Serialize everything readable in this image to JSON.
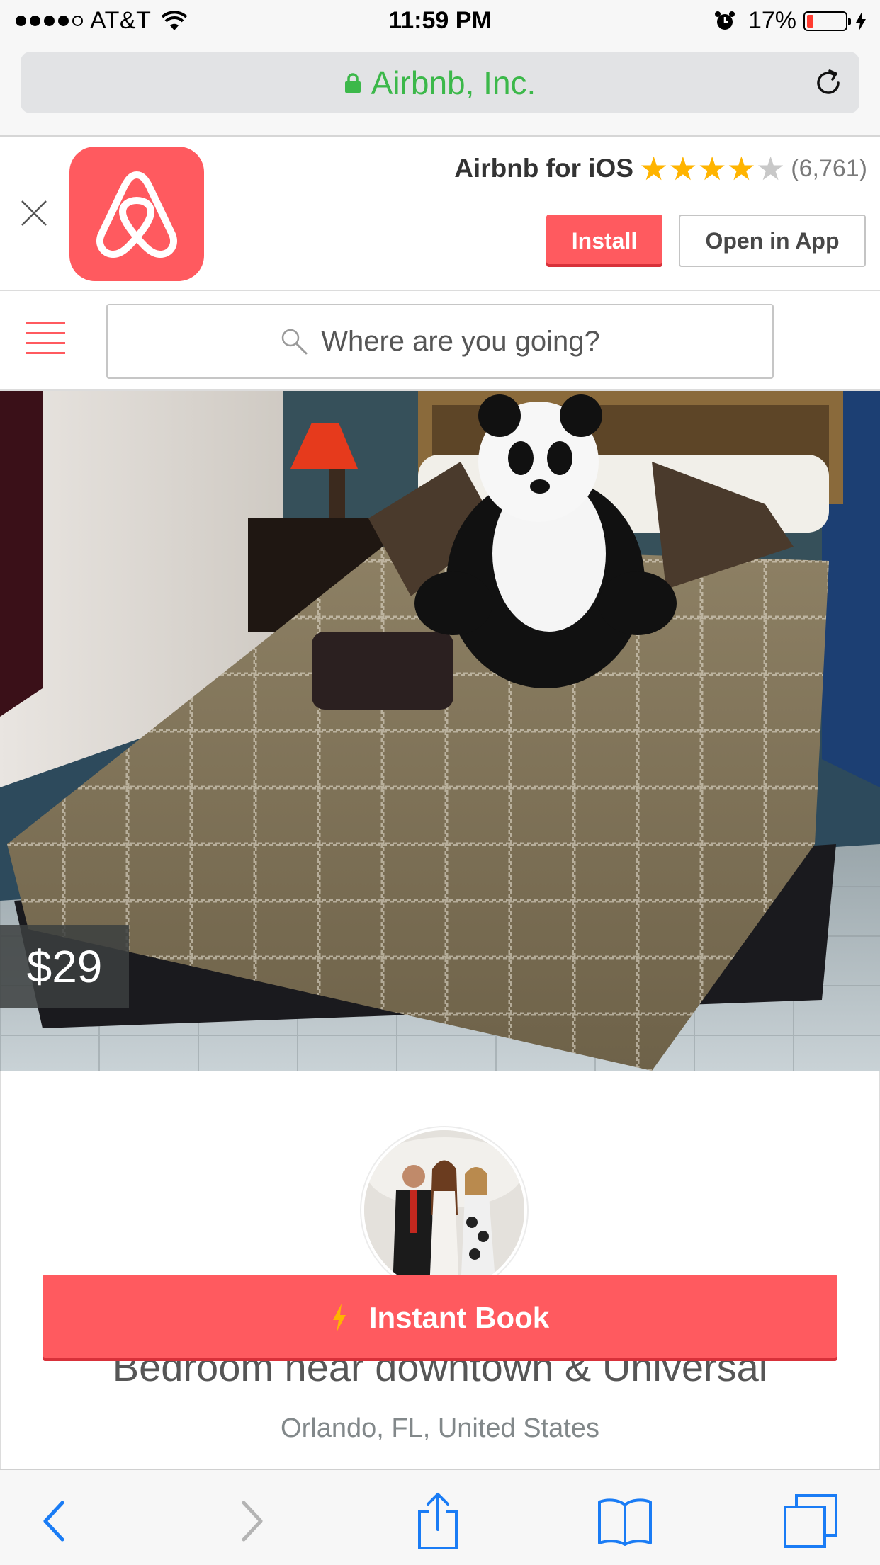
{
  "status_bar": {
    "carrier": "AT&T",
    "time": "11:59 PM",
    "battery_percent": "17%",
    "battery_level": 0.17,
    "signal_bars": 4,
    "icons": [
      "wifi-icon",
      "alarm-icon",
      "battery-icon",
      "charging-bolt-icon"
    ]
  },
  "browser": {
    "url_label": "Airbnb, Inc.",
    "secure": true,
    "url_color": "#3cb84a",
    "toolbar_icons": [
      "back-icon",
      "forward-icon",
      "share-icon",
      "bookmarks-icon",
      "tabs-icon"
    ]
  },
  "app_banner": {
    "app_name": "Airbnb for iOS",
    "rating_stars": 4,
    "rating_max": 5,
    "rating_count": "(6,761)",
    "install_label": "Install",
    "open_label": "Open in App"
  },
  "header": {
    "search_placeholder": "Where are you going?"
  },
  "listing": {
    "price": "$29",
    "title": "Bedroom near downtown & Universal",
    "location": "Orlando, FL, United States",
    "instant_book_label": "Instant Book"
  },
  "colors": {
    "brand": "#ff5a5f",
    "star": "#ffb400",
    "ios_blue": "#1a7cf5"
  }
}
